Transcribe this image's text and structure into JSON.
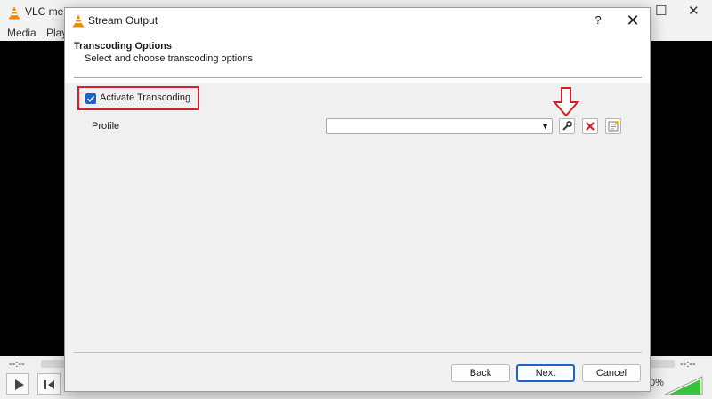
{
  "vlc": {
    "title": "VLC med",
    "menus": [
      "Media",
      "Play"
    ],
    "time_elapsed": "--:--",
    "time_total": "--:--",
    "volume": "0%"
  },
  "dialog": {
    "title": "Stream Output",
    "help": "?",
    "section_title": "Transcoding Options",
    "section_subtitle": "Select and choose transcoding options",
    "activate_label": "Activate Transcoding",
    "activate_checked": true,
    "profile_label": "Profile",
    "profile_value": "",
    "buttons": {
      "back": "Back",
      "next": "Next",
      "cancel": "Cancel"
    }
  },
  "icons": {
    "app": "vlc-cone-icon",
    "edit_profile": "wrench-icon",
    "delete_profile": "red-x-icon",
    "new_profile": "new-profile-icon",
    "annotation": "down-arrow-icon"
  },
  "colors": {
    "highlight": "#d3202a",
    "accent": "#1e63c9",
    "vlc_orange": "#f08a00"
  }
}
